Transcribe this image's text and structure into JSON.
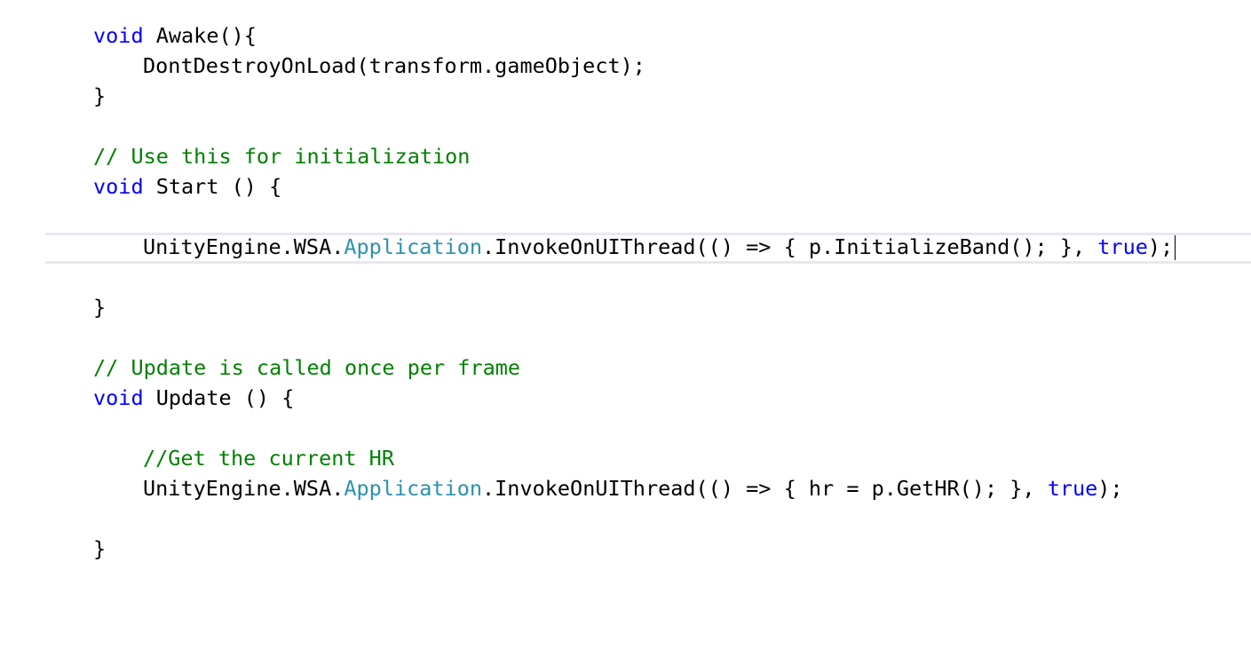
{
  "editor": {
    "colors": {
      "keyword": "#0000ff",
      "type": "#2b91af",
      "comment": "#008000",
      "text": "#000000",
      "current_line_border": "#e8e8ee"
    },
    "lines": {
      "awake_sig": {
        "kw": "void",
        "text": " Awake(){"
      },
      "awake_body": {
        "text": "DontDestroyOnLoad(transform.gameObject);"
      },
      "awake_close": {
        "text": "}"
      },
      "start_comment": {
        "text": "// Use this for initialization"
      },
      "start_sig": {
        "kw": "void",
        "text": " Start () {"
      },
      "start_body": {
        "pre": "UnityEngine.WSA.",
        "type": "Application",
        "mid": ".InvokeOnUIThread(() => { p.InitializeBand(); }, ",
        "kw": "true",
        "post": ");"
      },
      "start_close": {
        "text": "}"
      },
      "update_comment": {
        "text": "// Update is called once per frame"
      },
      "update_sig": {
        "kw": "void",
        "text": " Update () {"
      },
      "update_inner_comment": {
        "text": "//Get the current HR"
      },
      "update_body": {
        "pre": "UnityEngine.WSA.",
        "type": "Application",
        "mid": ".InvokeOnUIThread(() => { hr = p.GetHR(); }, ",
        "kw": "true",
        "post": ");"
      },
      "update_close": {
        "text": "}"
      }
    }
  }
}
